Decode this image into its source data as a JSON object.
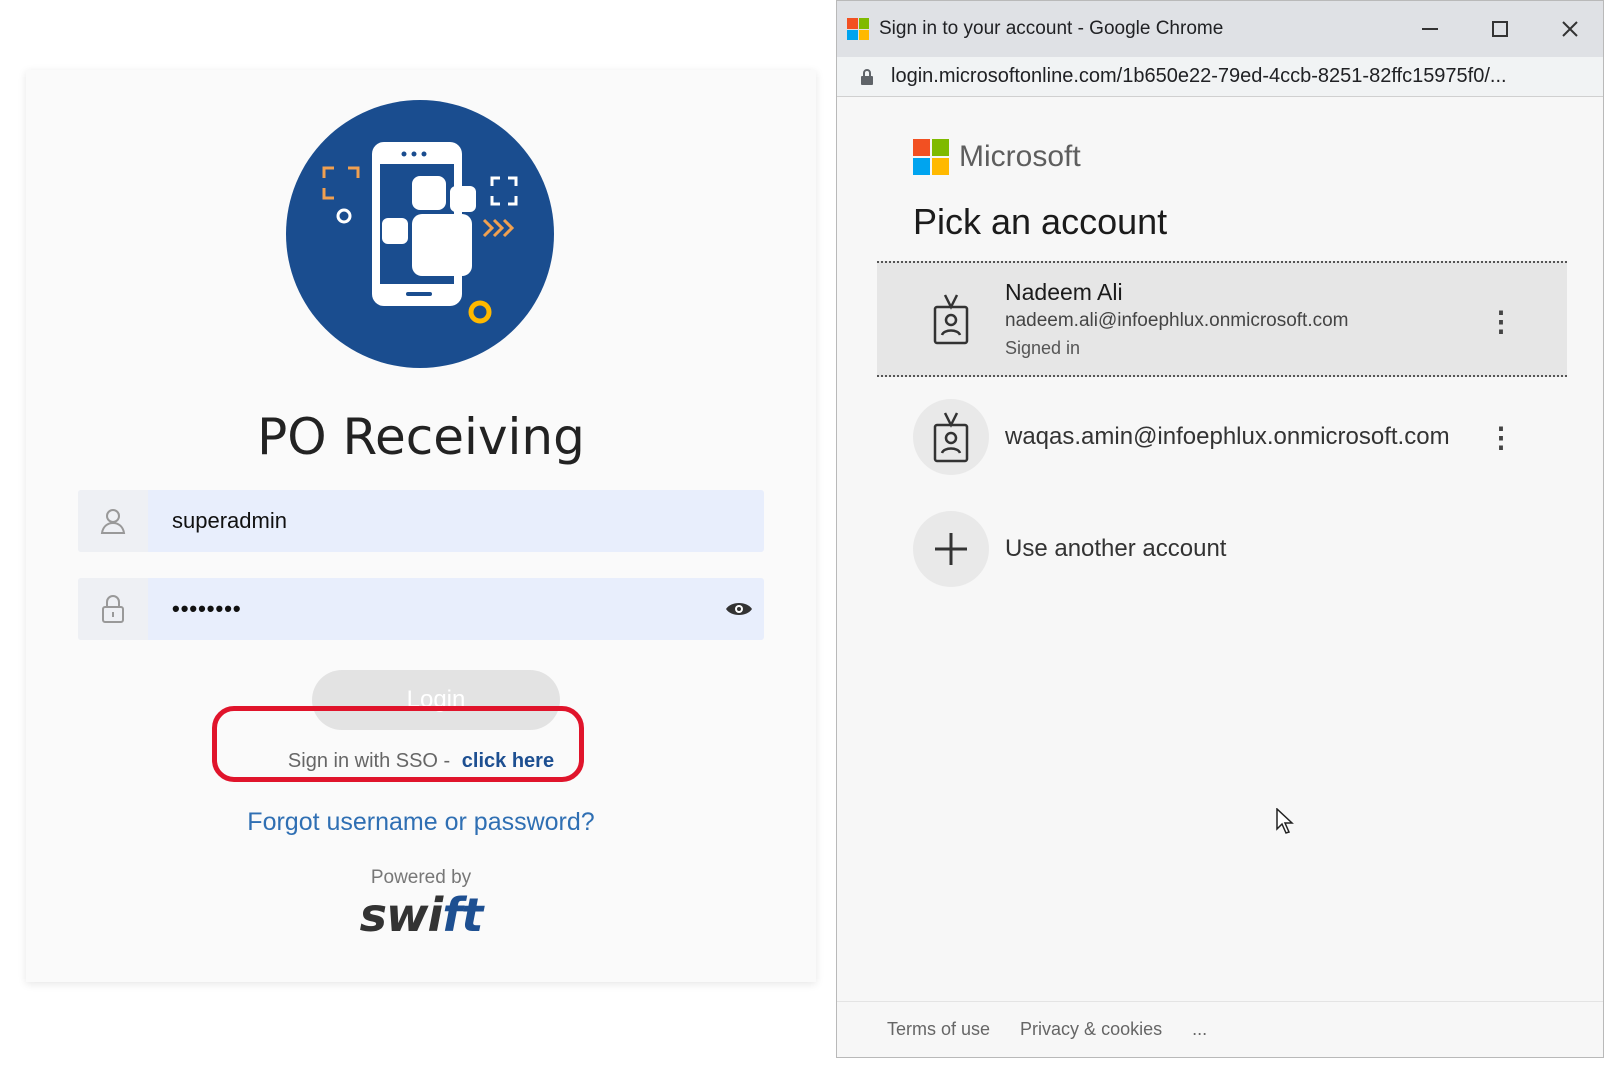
{
  "login": {
    "app_title": "PO Receiving",
    "username_value": "superadmin",
    "password_value": "••••••••",
    "login_button": "Login",
    "sso_text": "Sign in with SSO -",
    "sso_link": "click here",
    "forgot_link": "Forgot username or password?",
    "powered_by": "Powered by",
    "brand_prefix": "swi",
    "brand_suffix": "ft",
    "colors": {
      "logo_circle": "#1a4d8f",
      "accent_orange": "#f0a050",
      "highlight_red": "#e0142b",
      "link_blue": "#2f6fb3"
    }
  },
  "popup": {
    "window_title": "Sign in to your account - Google Chrome",
    "url": "login.microsoftonline.com/1b650e22-79ed-4ccb-8251-82ffc15975f0/...",
    "brand_name": "Microsoft",
    "heading": "Pick an account",
    "accounts": [
      {
        "name": "Nadeem Ali",
        "email": "nadeem.ali@infoephlux.onmicrosoft.com",
        "status": "Signed in"
      },
      {
        "email": "waqas.amin@infoephlux.onmicrosoft.com"
      }
    ],
    "use_another": "Use another account",
    "footer": {
      "terms": "Terms of use",
      "privacy": "Privacy & cookies",
      "more": "..."
    },
    "ms_colors": [
      "#f25022",
      "#7fba00",
      "#00a4ef",
      "#ffb900"
    ]
  }
}
